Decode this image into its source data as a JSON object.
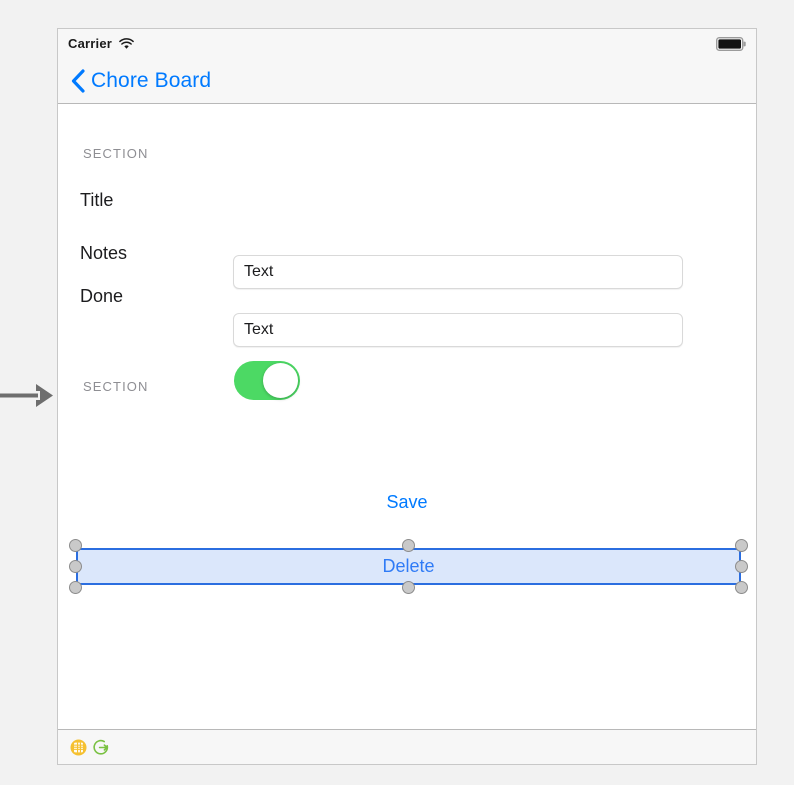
{
  "canvas": {
    "background_color": "#f2f2f2",
    "entry_arrow_name": "initial-view-controller-arrow"
  },
  "device": {
    "status_bar": {
      "carrier": "Carrier",
      "wifi_icon": "wifi-icon",
      "battery_icon": "battery-full-icon"
    },
    "nav_bar": {
      "back_chevron_icon": "chevron-left-icon",
      "back_title": "Chore Board",
      "tint_color": "#007aff"
    },
    "table": {
      "sections": [
        {
          "header": "SECTION",
          "rows": [
            {
              "label": "Title",
              "control": "text-field",
              "value": "Text",
              "placeholder": "Text"
            },
            {
              "label": "Notes",
              "control": "text-field",
              "value": "Text",
              "placeholder": "Text"
            },
            {
              "label": "Done",
              "control": "switch",
              "switch_on": true,
              "switch_on_color": "#4cd964"
            }
          ]
        },
        {
          "header": "SECTION",
          "rows": []
        }
      ]
    },
    "buttons": {
      "save_label": "Save",
      "save_color": "#007aff",
      "delete_label": "Delete",
      "delete_color": "#2f7bf6",
      "delete_selected": true,
      "delete_selection_fill": "#dbe7fb",
      "delete_selection_border": "#2b6ee0"
    },
    "scene_bar": {
      "icons": [
        {
          "name": "table-view-controller-icon",
          "color": "#f5c030"
        },
        {
          "name": "exit-segue-icon",
          "color": "#7ac143"
        }
      ]
    }
  }
}
